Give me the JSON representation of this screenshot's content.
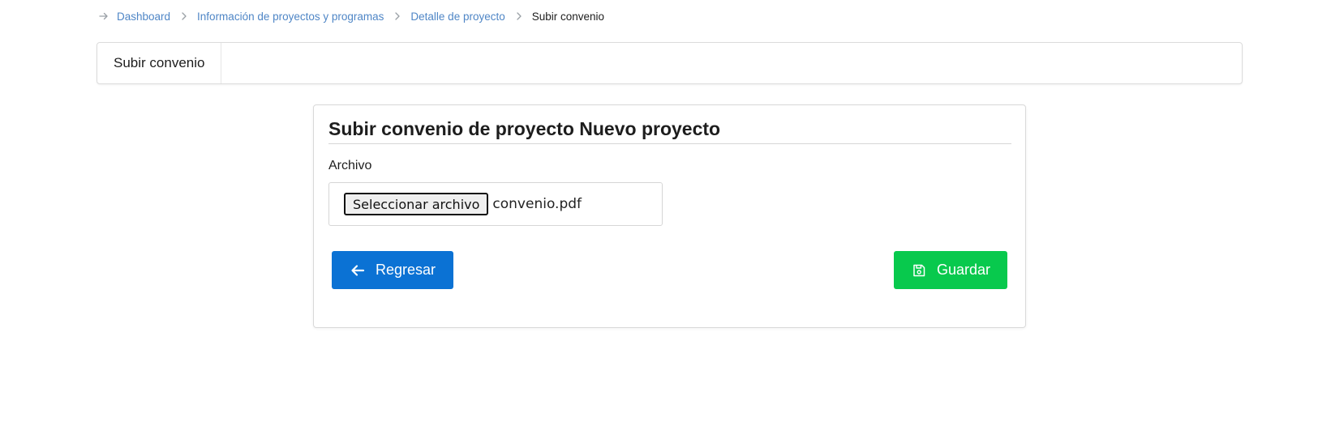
{
  "breadcrumb": {
    "items": [
      {
        "label": "Dashboard"
      },
      {
        "label": "Información de proyectos y programas"
      },
      {
        "label": "Detalle de proyecto"
      }
    ],
    "current": "Subir convenio"
  },
  "tabs": [
    {
      "label": "Subir convenio"
    }
  ],
  "card": {
    "title": "Subir convenio de proyecto Nuevo proyecto",
    "field_label": "Archivo",
    "file_button_label": "Seleccionar archivo",
    "file_name": "convenio.pdf",
    "back_label": "Regresar",
    "save_label": "Guardar"
  },
  "colors": {
    "link": "#4f86c6",
    "primary": "#0b72d4",
    "success": "#08c94d"
  },
  "icons": {
    "breadcrumb_start": "arrow-right-icon",
    "breadcrumb_separator": "chevron-right-icon",
    "back": "arrow-left-icon",
    "save": "save-icon"
  }
}
